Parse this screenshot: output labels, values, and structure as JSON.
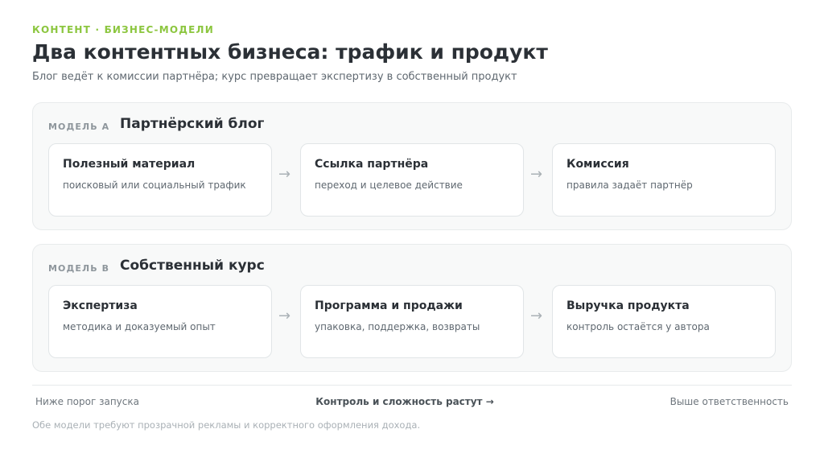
{
  "header": {
    "kicker": "КОНТЕНТ · БИЗНЕС-МОДЕЛИ",
    "title": "Два контентных бизнеса: трафик и продукт",
    "subtitle": "Блог ведёт к комиссии партнёра; курс превращает экспертизу в собственный продукт"
  },
  "models": [
    {
      "tag": "МОДЕЛЬ А",
      "name": "Партнёрский блог",
      "steps": [
        {
          "title": "Полезный материал",
          "desc": "поисковый или социальный трафик"
        },
        {
          "title": "Ссылка партнёра",
          "desc": "переход и целевое действие"
        },
        {
          "title": "Комиссия",
          "desc": "правила задаёт партнёр"
        }
      ]
    },
    {
      "tag": "МОДЕЛЬ В",
      "name": "Собственный курс",
      "steps": [
        {
          "title": "Экспертиза",
          "desc": "методика и доказуемый опыт"
        },
        {
          "title": "Программа и продажи",
          "desc": "упаковка, поддержка, возвраты"
        },
        {
          "title": "Выручка продукта",
          "desc": "контроль остаётся у автора"
        }
      ]
    }
  ],
  "arrow_glyph": "→",
  "scale": {
    "left": "Ниже порог запуска",
    "center": "Контроль и сложность растут →",
    "right": "Выше ответственность"
  },
  "footnote": "Обе модели требуют прозрачной рекламы и корректного оформления дохода.",
  "colors": {
    "accent": "#8cc63f",
    "panel_bg": "#f8f9f9",
    "card_bg": "#ffffff",
    "text": "#2b3036",
    "muted": "#5f6870"
  }
}
